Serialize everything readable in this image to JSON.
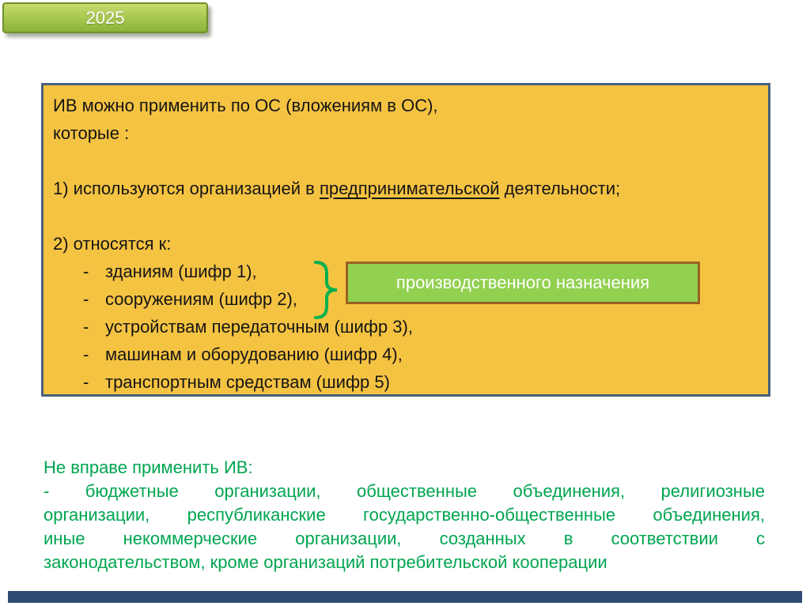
{
  "year_badge": {
    "label": "2025",
    "fill": "#8db23a",
    "border": "#6f8f2b",
    "text_color": "#ffffff"
  },
  "main_box": {
    "fill": "#F5C342",
    "border": "#46607C",
    "intro_line1": "ИВ можно применить по ОС (вложениям в ОС),",
    "intro_line2": "которые :",
    "point1_prefix": "1) используются организацией в ",
    "point1_underlined": "предпринимательской",
    "point1_suffix": " деятельности;",
    "point2": "2) относятся к:",
    "dash": "-",
    "list": [
      "зданиям (шифр 1),",
      "сооружениям (шифр 2),",
      "устройствам передаточным (шифр 3),",
      "машинам и оборудованию (шифр 4),",
      "транспортным средствам (шифр 5)"
    ]
  },
  "callout": {
    "label": "производственного назначения",
    "fill": "#92D050",
    "border": "#9A6220",
    "text_color": "#ffffff",
    "brace_color": "#00B050"
  },
  "restriction": {
    "color": "#00A550",
    "heading": "Не вправе применить ИВ:",
    "justified_lines": [
      "- бюджетные организации, общественные объединения, религиозные",
      "организации, республиканские государственно-общественные объединения,",
      "иные некоммерческие организации, созданных в соответствии с"
    ],
    "last_line": "законодательством, кроме организаций потребительской кооперации"
  },
  "footer_bar": {
    "color": "#2E4A73"
  }
}
